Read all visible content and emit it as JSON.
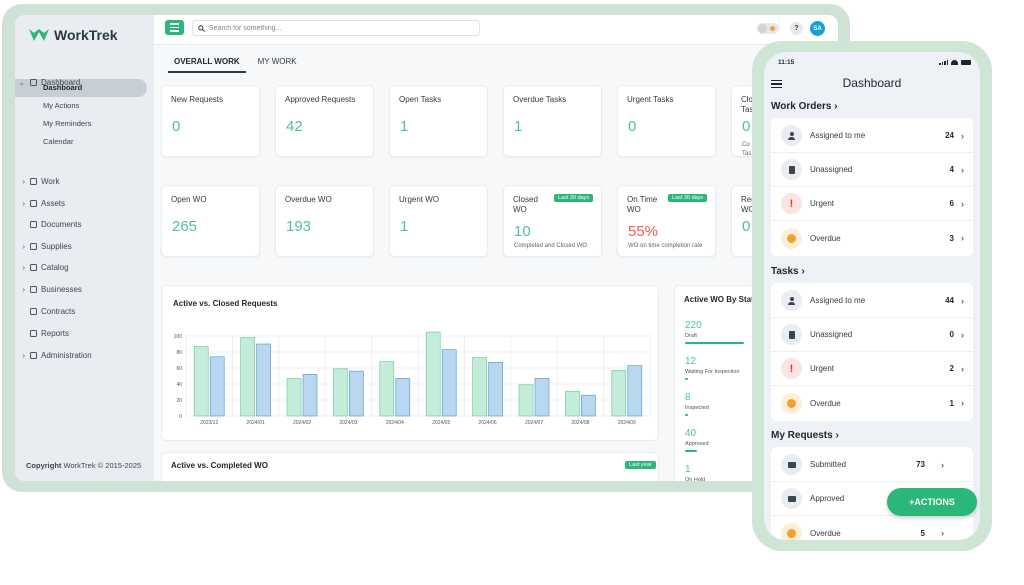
{
  "app": {
    "name": "WorkTrek",
    "copyright_brand": "Copyright",
    "copyright_rest": "WorkTrek © 2015-2025"
  },
  "sidebar": {
    "items": [
      {
        "label": "Dashboard",
        "icon": "dashboard-icon"
      },
      {
        "label": "Work",
        "icon": "wrench-icon"
      },
      {
        "label": "Assets",
        "icon": "box-icon"
      },
      {
        "label": "Documents",
        "icon": "folder-icon"
      },
      {
        "label": "Supplies",
        "icon": "supplies-icon"
      },
      {
        "label": "Catalog",
        "icon": "catalog-icon"
      },
      {
        "label": "Businesses",
        "icon": "person-icon"
      },
      {
        "label": "Contracts",
        "icon": "contract-icon"
      },
      {
        "label": "Reports",
        "icon": "report-icon"
      },
      {
        "label": "Administration",
        "icon": "admin-icon"
      }
    ],
    "sub_items": [
      "Dashboard",
      "My Actions",
      "My Reminders",
      "Calendar"
    ]
  },
  "topbar": {
    "search_placeholder": "Search for something...",
    "avatar": "SA",
    "help": "?"
  },
  "tabs": [
    "OVERALL WORK",
    "MY WORK"
  ],
  "cards_row1": [
    {
      "label": "New Requests",
      "value": "0"
    },
    {
      "label": "Approved Requests",
      "value": "42"
    },
    {
      "label": "Open Tasks",
      "value": "1"
    },
    {
      "label": "Overdue Tasks",
      "value": "1"
    },
    {
      "label": "Urgent Tasks",
      "value": "0"
    },
    {
      "label": "Clos Tas",
      "value": "0",
      "desc": "Co Tas"
    }
  ],
  "cards_row2": [
    {
      "label": "Open WO",
      "value": "265"
    },
    {
      "label": "Overdue WO",
      "value": "193"
    },
    {
      "label": "Urgent WO",
      "value": "1"
    },
    {
      "label": "Closed WO",
      "value": "10",
      "badge": "Last 30 days",
      "desc": "Completed and Closed WO"
    },
    {
      "label": "On Time WO",
      "value": "55%",
      "badge": "Last 30 days",
      "desc": "WO on time completion rate"
    },
    {
      "label": "Rec WO",
      "value": "0"
    }
  ],
  "charts": {
    "active_closed_title": "Active vs. Closed Requests",
    "active_completed_title": "Active vs. Completed WO",
    "last_year_badge": "Last year",
    "status_title": "Active WO By Statu",
    "status_items": [
      {
        "value": "220",
        "label": "Draft",
        "fill": 0.9
      },
      {
        "value": "12",
        "label": "Waiting For Inspection",
        "fill": 0.05
      },
      {
        "value": "8",
        "label": "Inspected",
        "fill": 0.04
      },
      {
        "value": "40",
        "label": "Approved",
        "fill": 0.18
      },
      {
        "value": "1",
        "label": "On Hold",
        "fill": 0.01
      }
    ]
  },
  "chart_data": {
    "type": "bar",
    "title": "Active vs. Closed Requests",
    "categories": [
      "2023/12",
      "2024/01",
      "2024/02",
      "2024/03",
      "2024/04",
      "2024/05",
      "2024/06",
      "2024/07",
      "2024/08",
      "2024/09"
    ],
    "series": [
      {
        "values": [
          87,
          98,
          47,
          59,
          68,
          105,
          73,
          39,
          31,
          57
        ],
        "color": "#c5ecd9"
      },
      {
        "values": [
          74,
          90,
          52,
          56,
          47,
          83,
          67,
          47,
          26,
          63
        ],
        "color": "#b9d8f0"
      }
    ],
    "ylim": [
      0,
      100
    ],
    "yticks": [
      "0",
      "20",
      "40",
      "60",
      "80",
      "100"
    ],
    "grid": true
  },
  "mobile": {
    "time": "11:15",
    "title": "Dashboard",
    "sections": [
      {
        "title": "Work Orders",
        "rows": [
          {
            "label": "Assigned to me",
            "count": "24",
            "icon": "person-icon"
          },
          {
            "label": "Unassigned",
            "count": "4",
            "icon": "document-icon"
          },
          {
            "label": "Urgent",
            "count": "6",
            "icon": "exclamation-icon"
          },
          {
            "label": "Overdue",
            "count": "3",
            "icon": "clock-icon"
          }
        ]
      },
      {
        "title": "Tasks",
        "rows": [
          {
            "label": "Assigned to me",
            "count": "44",
            "icon": "person-icon"
          },
          {
            "label": "Unassigned",
            "count": "0",
            "icon": "document-icon"
          },
          {
            "label": "Urgent",
            "count": "2",
            "icon": "exclamation-icon"
          },
          {
            "label": "Overdue",
            "count": "1",
            "icon": "clock-icon"
          }
        ]
      },
      {
        "title": "My Requests",
        "rows": [
          {
            "label": "Submitted",
            "count": "73",
            "icon": "truck-icon"
          },
          {
            "label": "Approved",
            "count": "",
            "icon": "thumbs-up-icon"
          },
          {
            "label": "Overdue",
            "count": "5",
            "icon": "clock-icon"
          }
        ]
      }
    ],
    "fab_label": "+ACTIONS"
  }
}
